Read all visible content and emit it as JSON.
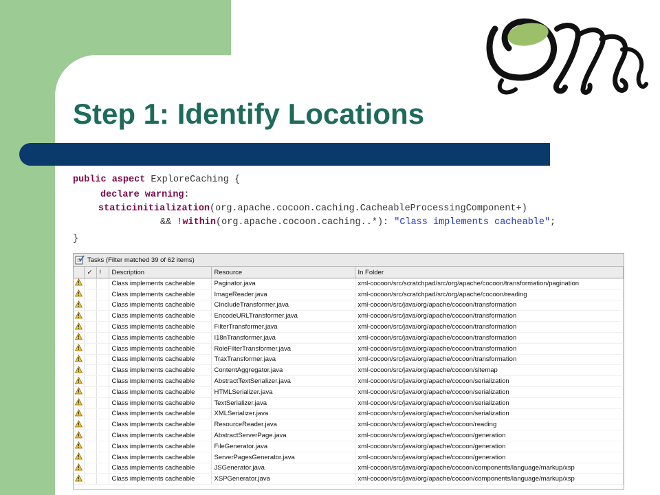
{
  "slide": {
    "title": "Step 1: Identify Locations",
    "colors": {
      "background_green": "#9ccb94",
      "title_teal": "#1e6b5c",
      "bar_navy": "#0a3a6b"
    }
  },
  "code": {
    "line1_kw": "public aspect",
    "line1_rest": " ExploreCaching {",
    "line2_kw": "declare warning",
    "line2_rest": ":",
    "line3_kw": "staticinitialization",
    "line3_rest": "(org.apache.cocoon.caching.CacheableProcessingComponent+)",
    "line4_pre": "&& !",
    "line4_kw": "within",
    "line4_rest": "(org.apache.cocoon.caching..*): ",
    "line4_str": "\"Class implements cacheable\"",
    "line4_end": ";",
    "line5": "}"
  },
  "tasks": {
    "title": "Tasks (Filter matched 39 of 62 items)",
    "columns": {
      "check": "✓",
      "priority": "!",
      "description": "Description",
      "resource": "Resource",
      "folder": "In Folder"
    },
    "rows": [
      {
        "description": "Class implements cacheable",
        "resource": "Paginator.java",
        "folder": "xml-cocoon/src/scratchpad/src/org/apache/cocoon/transformation/pagination"
      },
      {
        "description": "Class implements cacheable",
        "resource": "ImageReader.java",
        "folder": "xml-cocoon/src/scratchpad/src/org/apache/cocoon/reading"
      },
      {
        "description": "Class implements cacheable",
        "resource": "CIncludeTransformer.java",
        "folder": "xml-cocoon/src/java/org/apache/cocoon/transformation"
      },
      {
        "description": "Class implements cacheable",
        "resource": "EncodeURLTransformer.java",
        "folder": "xml-cocoon/src/java/org/apache/cocoon/transformation"
      },
      {
        "description": "Class implements cacheable",
        "resource": "FilterTransformer.java",
        "folder": "xml-cocoon/src/java/org/apache/cocoon/transformation"
      },
      {
        "description": "Class implements cacheable",
        "resource": "I18nTransformer.java",
        "folder": "xml-cocoon/src/java/org/apache/cocoon/transformation"
      },
      {
        "description": "Class implements cacheable",
        "resource": "RoleFilterTransformer.java",
        "folder": "xml-cocoon/src/java/org/apache/cocoon/transformation"
      },
      {
        "description": "Class implements cacheable",
        "resource": "TraxTransformer.java",
        "folder": "xml-cocoon/src/java/org/apache/cocoon/transformation"
      },
      {
        "description": "Class implements cacheable",
        "resource": "ContentAggregator.java",
        "folder": "xml-cocoon/src/java/org/apache/cocoon/sitemap"
      },
      {
        "description": "Class implements cacheable",
        "resource": "AbstractTextSerializer.java",
        "folder": "xml-cocoon/src/java/org/apache/cocoon/serialization"
      },
      {
        "description": "Class implements cacheable",
        "resource": "HTMLSerializer.java",
        "folder": "xml-cocoon/src/java/org/apache/cocoon/serialization"
      },
      {
        "description": "Class implements cacheable",
        "resource": "TextSerializer.java",
        "folder": "xml-cocoon/src/java/org/apache/cocoon/serialization"
      },
      {
        "description": "Class implements cacheable",
        "resource": "XMLSerializer.java",
        "folder": "xml-cocoon/src/java/org/apache/cocoon/serialization"
      },
      {
        "description": "Class implements cacheable",
        "resource": "ResourceReader.java",
        "folder": "xml-cocoon/src/java/org/apache/cocoon/reading"
      },
      {
        "description": "Class implements cacheable",
        "resource": "AbstractServerPage.java",
        "folder": "xml-cocoon/src/java/org/apache/cocoon/generation"
      },
      {
        "description": "Class implements cacheable",
        "resource": "FileGenerator.java",
        "folder": "xml-cocoon/src/java/org/apache/cocoon/generation"
      },
      {
        "description": "Class implements cacheable",
        "resource": "ServerPagesGenerator.java",
        "folder": "xml-cocoon/src/java/org/apache/cocoon/generation"
      },
      {
        "description": "Class implements cacheable",
        "resource": "JSGenerator.java",
        "folder": "xml-cocoon/src/java/org/apache/cocoon/components/language/markup/xsp"
      },
      {
        "description": "Class implements cacheable",
        "resource": "XSPGenerator.java",
        "folder": "xml-cocoon/src/java/org/apache/cocoon/components/language/markup/xsp"
      }
    ]
  }
}
